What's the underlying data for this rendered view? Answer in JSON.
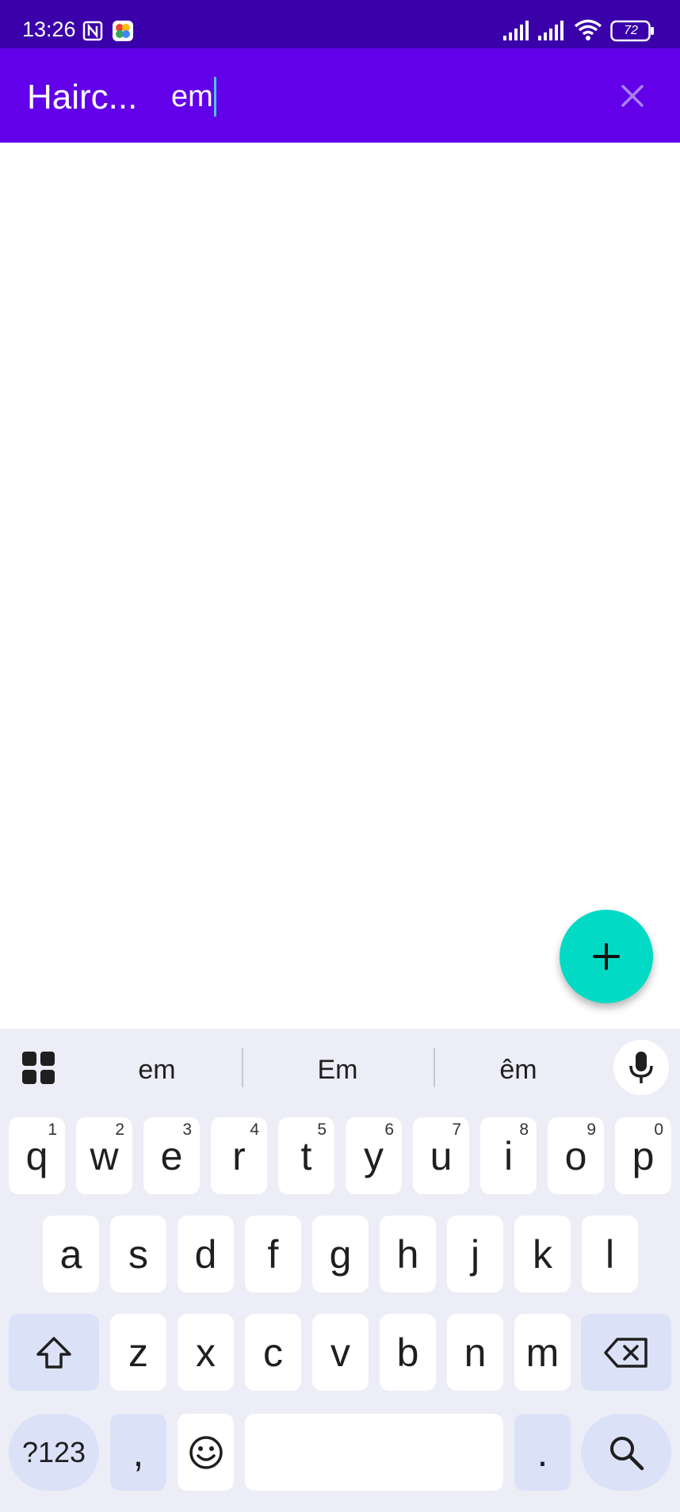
{
  "status_bar": {
    "time": "13:26",
    "battery": "72",
    "icons": [
      "nfc-icon",
      "app-notification-icon",
      "signal-icon",
      "signal-icon",
      "wifi-icon",
      "battery-icon"
    ]
  },
  "app_bar": {
    "title": "Hairc...",
    "search_value": "em",
    "close_icon": "close-icon"
  },
  "fab": {
    "icon": "add-icon"
  },
  "keyboard": {
    "suggestions": [
      "em",
      "Em",
      "êm"
    ],
    "row1": [
      {
        "key": "q",
        "hint": "1"
      },
      {
        "key": "w",
        "hint": "2"
      },
      {
        "key": "e",
        "hint": "3"
      },
      {
        "key": "r",
        "hint": "4"
      },
      {
        "key": "t",
        "hint": "5"
      },
      {
        "key": "y",
        "hint": "6"
      },
      {
        "key": "u",
        "hint": "7"
      },
      {
        "key": "i",
        "hint": "8"
      },
      {
        "key": "o",
        "hint": "9"
      },
      {
        "key": "p",
        "hint": "0"
      }
    ],
    "row2": [
      "a",
      "s",
      "d",
      "f",
      "g",
      "h",
      "j",
      "k",
      "l"
    ],
    "row3": [
      "z",
      "x",
      "c",
      "v",
      "b",
      "n",
      "m"
    ],
    "symbols_label": "?123",
    "comma": ",",
    "period": "."
  },
  "colors": {
    "status_bar": "#3a00aa",
    "app_bar": "#6200ea",
    "fab": "#03dac5",
    "keyboard_bg": "#ecedf6",
    "function_key": "#dbe2f8"
  }
}
